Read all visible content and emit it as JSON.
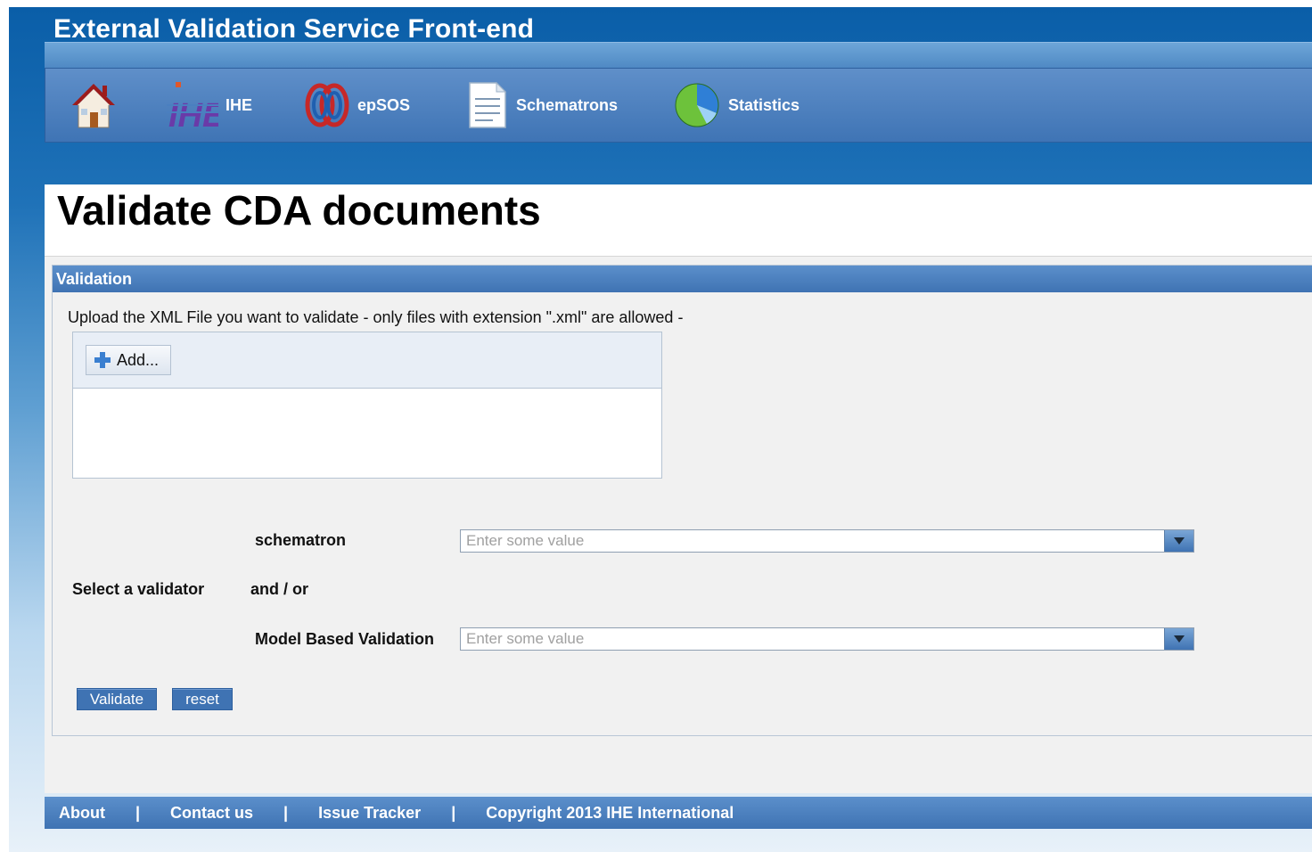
{
  "header": {
    "title": "External Validation Service Front-end"
  },
  "nav": {
    "items": [
      {
        "label": "",
        "icon": "home-icon"
      },
      {
        "label": "IHE",
        "icon": "ihe-logo-icon"
      },
      {
        "label": "epSOS",
        "icon": "epsos-logo-icon"
      },
      {
        "label": "Schematrons",
        "icon": "document-icon"
      },
      {
        "label": "Statistics",
        "icon": "pie-chart-icon"
      }
    ]
  },
  "page": {
    "title": "Validate CDA documents"
  },
  "validation": {
    "panel_title": "Validation",
    "upload_text": "Upload the XML File you want to validate - only files with extension \".xml\" are allowed -",
    "add_label": "Add...",
    "select_validator_label": "Select a validator",
    "and_or_label": "and / or",
    "schematron_label": "schematron",
    "schematron_placeholder": "Enter some value",
    "model_based_label": "Model Based Validation",
    "model_based_placeholder": "Enter some value",
    "validate_label": "Validate",
    "reset_label": "reset"
  },
  "footer": {
    "about": "About",
    "contact": "Contact us",
    "issue_tracker": "Issue Tracker",
    "copyright": "Copyright 2013 IHE International",
    "separator": "|"
  },
  "colors": {
    "header_blue": "#0a5ea8",
    "nav_blue": "#3f74b5",
    "button_blue": "#3f73b3",
    "content_gray": "#f1f1f1"
  }
}
